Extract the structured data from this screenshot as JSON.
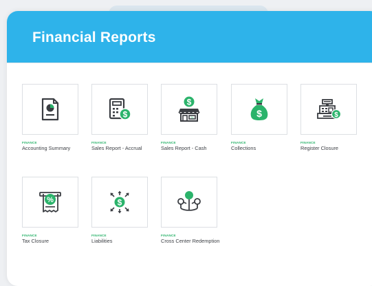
{
  "header": {
    "title": "Financial Reports"
  },
  "colors": {
    "accent": "#2eb3ea",
    "green": "#2bb36b",
    "icon_dark": "#3a3d42"
  },
  "reports": [
    {
      "category": "FINANCE",
      "name": "Accounting Summary",
      "icon": "document-chart-icon"
    },
    {
      "category": "FINANCE",
      "name": "Sales Report - Accrual",
      "icon": "calculator-dollar-icon"
    },
    {
      "category": "FINANCE",
      "name": "Sales Report - Cash",
      "icon": "storefront-dollar-icon"
    },
    {
      "category": "FINANCE",
      "name": "Collections",
      "icon": "money-bag-icon"
    },
    {
      "category": "FINANCE",
      "name": "Register Closure",
      "icon": "cash-register-icon"
    },
    {
      "category": "FINANCE",
      "name": "Tax Closure",
      "icon": "tax-receipt-icon"
    },
    {
      "category": "FINANCE",
      "name": "Liabilities",
      "icon": "dollar-arrows-icon"
    },
    {
      "category": "FINANCE",
      "name": "Cross Center Redemption",
      "icon": "location-network-icon"
    }
  ]
}
